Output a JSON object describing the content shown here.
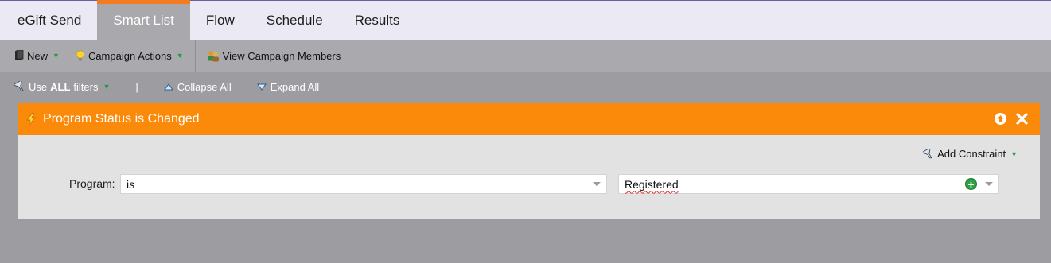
{
  "tabs": [
    {
      "label": "eGift Send",
      "active": false
    },
    {
      "label": "Smart List",
      "active": true
    },
    {
      "label": "Flow",
      "active": false
    },
    {
      "label": "Schedule",
      "active": false
    },
    {
      "label": "Results",
      "active": false
    }
  ],
  "toolbar": {
    "new_label": "New",
    "campaign_actions_label": "Campaign Actions",
    "view_members_label": "View Campaign Members"
  },
  "filters": {
    "use_prefix": "Use",
    "use_bold": "ALL",
    "use_suffix": "filters",
    "separator": "|",
    "collapse_label": "Collapse All",
    "expand_label": "Expand All"
  },
  "trigger": {
    "title": "Program Status is Changed",
    "add_constraint_label": "Add Constraint",
    "program_label": "Program:",
    "operator_value": "is",
    "status_value": "Registered"
  },
  "colors": {
    "accent_orange": "#fb8a0a",
    "tab_active_bar": "#f47b20",
    "caret_green": "#1d9e3a",
    "page_bg": "#9d9ca1"
  }
}
